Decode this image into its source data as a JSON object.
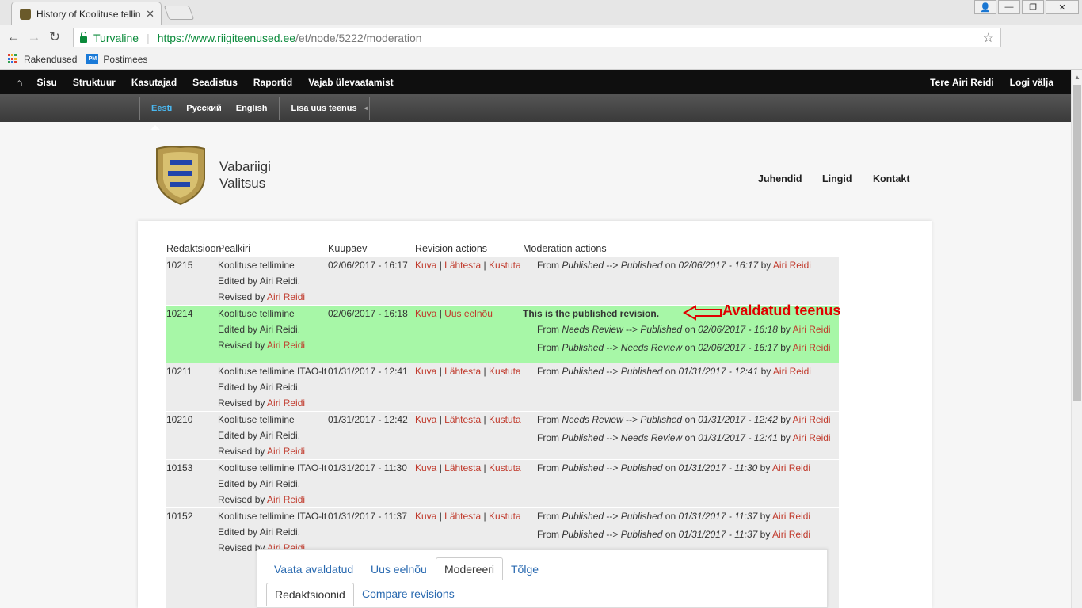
{
  "browser": {
    "tab_title": "History of Koolituse tellin",
    "secure_label": "Turvaline",
    "url_host": "https://www.riigiteenused.ee",
    "url_path": "/et/node/5222/moderation",
    "bookmarks": [
      "Rakendused",
      "Postimees"
    ]
  },
  "admin": {
    "menu": [
      "Sisu",
      "Struktuur",
      "Kasutajad",
      "Seadistus",
      "Raportid",
      "Vajab ülevaatamist"
    ],
    "greeting": "Tere",
    "user": "Airi Reidi",
    "logout": "Logi välja",
    "sub": [
      "Eesti",
      "Русский",
      "English",
      "Lisa uus teenus"
    ]
  },
  "site": {
    "brand_line1": "Vabariigi",
    "brand_line2": "Valitsus",
    "nav": [
      "Juhendid",
      "Lingid",
      "Kontakt"
    ]
  },
  "table": {
    "headers": [
      "Redaktsioon",
      "Pealkiri",
      "Kuupäev",
      "Revision actions",
      "Moderation actions"
    ],
    "edited_by": "Edited by Airi Reidi.",
    "revised_by": "Revised by",
    "revised_user": "Airi Reidi",
    "published_note": "This is the published revision.",
    "actions": {
      "view": "Kuva",
      "revert": "Lähtesta",
      "delete": "Kustuta",
      "new_draft": "Uus eelnõu"
    },
    "rows": [
      {
        "id": "10215",
        "title": "Koolituse tellimine",
        "date": "02/06/2017 - 16:17",
        "published": false,
        "mods": [
          {
            "from": "Published",
            "to": "Published",
            "date": "02/06/2017 - 16:17"
          }
        ]
      },
      {
        "id": "10214",
        "title": "Koolituse tellimine",
        "date": "02/06/2017 - 16:18",
        "published": true,
        "mods": [
          {
            "from": "Needs Review",
            "to": "Published",
            "date": "02/06/2017 - 16:18"
          },
          {
            "from": "Published",
            "to": "Needs Review",
            "date": "02/06/2017 - 16:17"
          }
        ]
      },
      {
        "id": "10211",
        "title": "Koolituse tellimine ITAO-lt",
        "date": "01/31/2017 - 12:41",
        "published": false,
        "mods": [
          {
            "from": "Published",
            "to": "Published",
            "date": "01/31/2017 - 12:41"
          }
        ]
      },
      {
        "id": "10210",
        "title": "Koolituse tellimine",
        "date": "01/31/2017 - 12:42",
        "published": false,
        "mods": [
          {
            "from": "Needs Review",
            "to": "Published",
            "date": "01/31/2017 - 12:42"
          },
          {
            "from": "Published",
            "to": "Needs Review",
            "date": "01/31/2017 - 12:41"
          }
        ]
      },
      {
        "id": "10153",
        "title": "Koolituse tellimine ITAO-lt",
        "date": "01/31/2017 - 11:30",
        "published": false,
        "mods": [
          {
            "from": "Published",
            "to": "Published",
            "date": "01/31/2017 - 11:30"
          }
        ]
      },
      {
        "id": "10152",
        "title": "Koolituse tellimine ITAO-lt",
        "date": "01/31/2017 - 11:37",
        "published": false,
        "mods": [
          {
            "from": "Published",
            "to": "Published",
            "date": "01/31/2017 - 11:37"
          },
          {
            "from": "Published",
            "to": "Published",
            "date": "01/31/2017 - 11:37"
          }
        ]
      }
    ]
  },
  "annotation": "Avaldatud teenus",
  "page_tabs": {
    "primary": [
      "Vaata avaldatud",
      "Uus eelnõu",
      "Modereeri",
      "Tõlge"
    ],
    "secondary": [
      "Redaktsioonid",
      "Compare revisions"
    ]
  },
  "colors": {
    "link_red": "#c0392b",
    "published_row": "#a7f7a7",
    "row_bg": "#ececec",
    "annotation": "#e00000"
  }
}
